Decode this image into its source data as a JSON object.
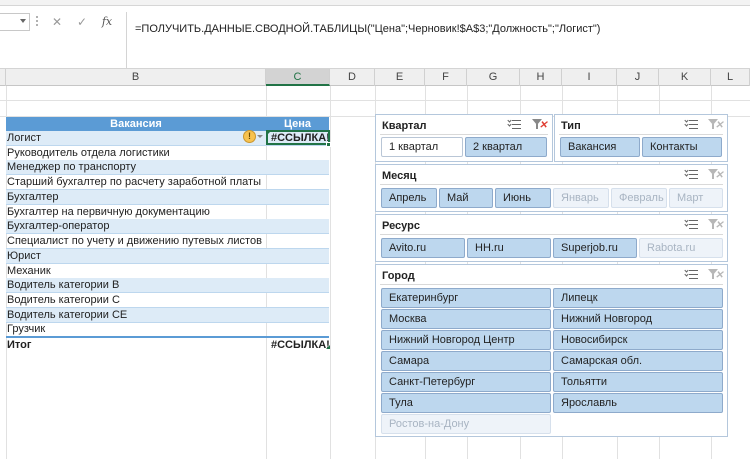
{
  "formula_bar": {
    "cancel_icon": "close-icon",
    "enter_icon": "check-icon",
    "fx_label": "fx",
    "formula": "=ПОЛУЧИТЬ.ДАННЫЕ.СВОДНОЙ.ТАБЛИЦЫ(\"Цена\";Черновик!$A$3;\"Должность\";\"Логист\")"
  },
  "columns": [
    "B",
    "C",
    "D",
    "E",
    "F",
    "G",
    "H",
    "I",
    "J",
    "K",
    "L"
  ],
  "pivot": {
    "header_label": "Вакансия",
    "header_value": "Цена",
    "rows": [
      {
        "label": "Логист",
        "value": "#ССЫЛКА!"
      },
      {
        "label": "Руководитель отдела логистики",
        "value": ""
      },
      {
        "label": "Менеджер по транспорту",
        "value": ""
      },
      {
        "label": "Старший бухгалтер по расчету заработной платы",
        "value": ""
      },
      {
        "label": "Бухгалтер",
        "value": ""
      },
      {
        "label": "Бухгалтер на первичную документацию",
        "value": ""
      },
      {
        "label": "Бухгалтер-оператор",
        "value": ""
      },
      {
        "label": "Специалист по учету и движению путевых листов",
        "value": ""
      },
      {
        "label": "Юрист",
        "value": ""
      },
      {
        "label": "Механик",
        "value": ""
      },
      {
        "label": "Водитель категории В",
        "value": ""
      },
      {
        "label": "Водитель категории С",
        "value": ""
      },
      {
        "label": "Водитель категории СЕ",
        "value": ""
      },
      {
        "label": "Грузчик",
        "value": ""
      }
    ],
    "total_label": "Итог",
    "total_value": "#ССЫЛКА!",
    "warning_icon": "warning-icon"
  },
  "slicers": {
    "quarter": {
      "title": "Квартал",
      "items": [
        "1 квартал",
        "2 квартал"
      ]
    },
    "type": {
      "title": "Тип",
      "items": [
        "Вакансия",
        "Контакты"
      ]
    },
    "month": {
      "title": "Месяц",
      "items": [
        "Апрель",
        "Май",
        "Июнь",
        "Январь",
        "Февраль",
        "Март"
      ]
    },
    "resource": {
      "title": "Ресурс",
      "items": [
        "Avito.ru",
        "HH.ru",
        "Superjob.ru",
        "Rabota.ru"
      ]
    },
    "city": {
      "title": "Город",
      "items": [
        "Екатеринбург",
        "Липецк",
        "Москва",
        "Нижний Новгород",
        "Нижний Новгород Центр",
        "Новосибирск",
        "Самара",
        "Самарская обл.",
        "Санкт-Петербург",
        "Тольятти",
        "Тула",
        "Ярославль",
        "Ростов-на-Дону"
      ]
    },
    "multi_select_icon": "multi-select-icon",
    "clear_filter_icon": "clear-filter-icon"
  },
  "colors": {
    "accent": "#217346",
    "pivot_header": "#5b9bd5",
    "pivot_band": "#ddebf7",
    "slicer_selected": "#bdd7ee",
    "clear_x": "#e03c31"
  }
}
